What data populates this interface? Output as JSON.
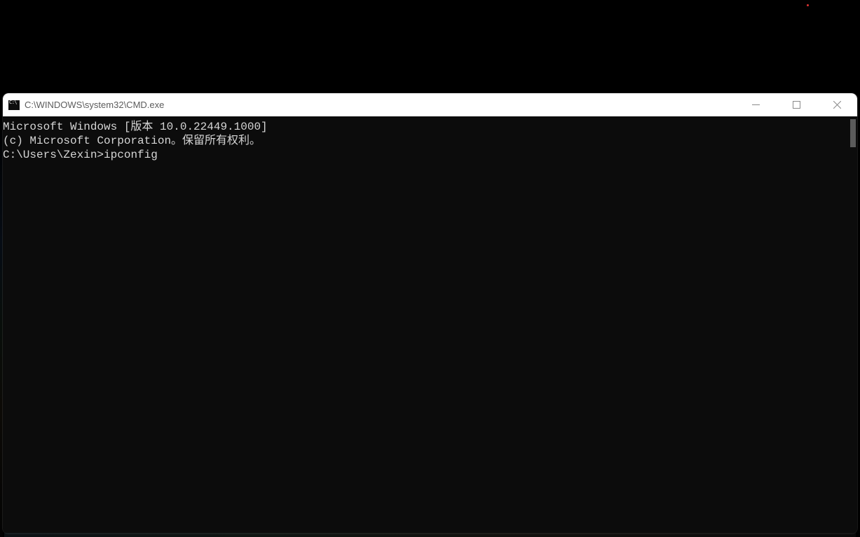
{
  "window": {
    "title": "C:\\WINDOWS\\system32\\CMD.exe"
  },
  "terminal": {
    "line1": "Microsoft Windows [版本 10.0.22449.1000]",
    "line2": "(c) Microsoft Corporation。保留所有权利。",
    "blank": "",
    "prompt": "C:\\Users\\Zexin>",
    "command": "ipconfig"
  }
}
